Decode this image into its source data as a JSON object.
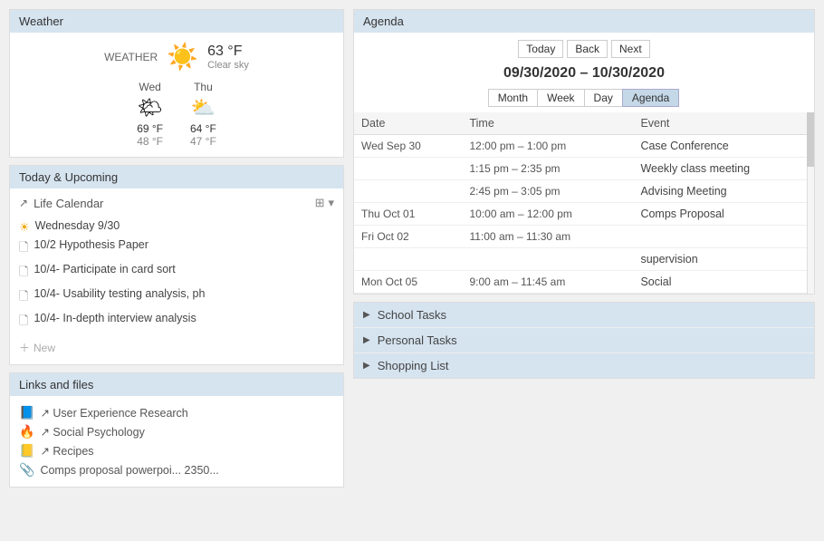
{
  "weather": {
    "section_title": "Weather",
    "label": "WEATHER",
    "current_temp": "63 °F",
    "current_desc": "Clear sky",
    "icon": "☀️",
    "forecast": [
      {
        "day": "Wed",
        "icon": "🌤",
        "high": "69 °F",
        "low": "48 °F"
      },
      {
        "day": "Thu",
        "icon": "⛅",
        "high": "64 °F",
        "low": "47 °F"
      }
    ]
  },
  "upcoming": {
    "section_title": "Today & Upcoming",
    "calendar_name": "Life Calendar",
    "tasks": [
      {
        "icon": "sun",
        "text": "Wednesday 9/30"
      },
      {
        "icon": "doc",
        "text": "10/2 Hypothesis Paper"
      },
      {
        "icon": "doc",
        "text": "10/4- Participate in card sort"
      },
      {
        "icon": "doc",
        "text": "10/4- Usability testing analysis, ph"
      },
      {
        "icon": "doc",
        "text": "10/4- In-depth interview analysis"
      }
    ],
    "add_label": "New"
  },
  "links": {
    "section_title": "Links and files",
    "items": [
      {
        "icon": "📘",
        "text": "↗ User Experience Research"
      },
      {
        "icon": "🔥",
        "text": "↗ Social Psychology"
      },
      {
        "icon": "📒",
        "text": "↗ Recipes"
      },
      {
        "icon": "📎",
        "text": "Comps proposal powerpoi...  2350..."
      }
    ]
  },
  "agenda": {
    "section_title": "Agenda",
    "nav_buttons": [
      "Today",
      "Back",
      "Next"
    ],
    "date_range": "09/30/2020 – 10/30/2020",
    "view_tabs": [
      "Month",
      "Week",
      "Day",
      "Agenda"
    ],
    "active_tab": "Agenda",
    "columns": [
      "Date",
      "Time",
      "Event"
    ],
    "rows": [
      {
        "date": "Wed Sep 30",
        "time": "12:00 pm – 1:00 pm",
        "event": "Case Conference"
      },
      {
        "date": "",
        "time": "1:15 pm – 2:35 pm",
        "event": "Weekly class meeting"
      },
      {
        "date": "",
        "time": "2:45 pm – 3:05 pm",
        "event": "Advising Meeting"
      },
      {
        "date": "Thu Oct 01",
        "time": "10:00 am – 12:00 pm",
        "event": "Comps Proposal"
      },
      {
        "date": "Fri Oct 02",
        "time": "11:00 am – 11:30 am",
        "event": ""
      },
      {
        "date": "",
        "time": "",
        "event": "supervision"
      },
      {
        "date": "Mon Oct 05",
        "time": "9:00 am – 11:45 am",
        "event": "Social"
      }
    ]
  },
  "task_lists": [
    {
      "label": "School Tasks"
    },
    {
      "label": "Personal Tasks"
    },
    {
      "label": "Shopping List"
    }
  ]
}
